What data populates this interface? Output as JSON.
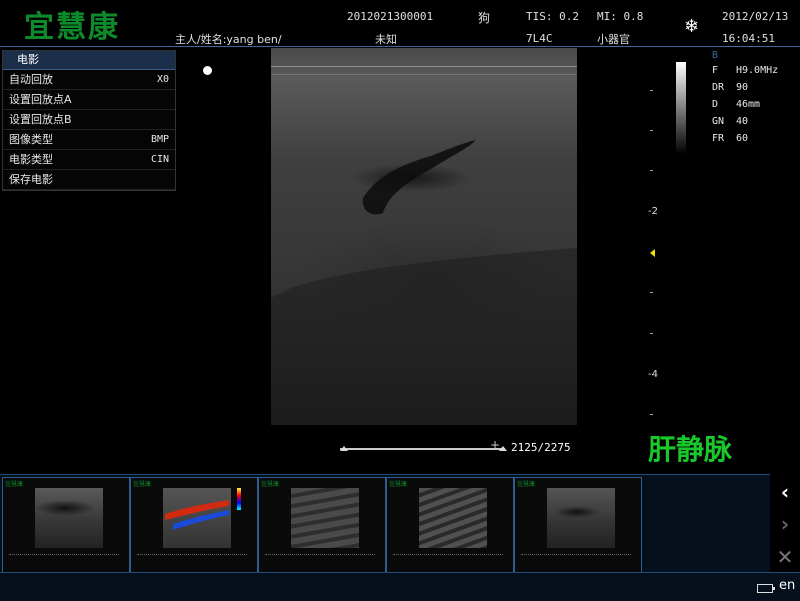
{
  "header": {
    "logo": "宜慧康",
    "patient_id": "2012021300001",
    "species": "狗",
    "tis": "TIS: 0.2",
    "mi": "MI: 0.8",
    "date": "2012/02/13",
    "owner": "主人/姓名:yang ben/",
    "gender": "未知",
    "probe": "7L4C",
    "preset": "小器官",
    "time": "16:04:51",
    "freeze_icon": "snowflake-icon"
  },
  "menu": {
    "title": "电影",
    "items": [
      {
        "label": "自动回放",
        "value": "X0"
      },
      {
        "label": "设置回放点A",
        "value": ""
      },
      {
        "label": "设置回放点B",
        "value": ""
      },
      {
        "label": "图像类型",
        "value": "BMP"
      },
      {
        "label": "电影类型",
        "value": "CIN"
      },
      {
        "label": "保存电影",
        "value": ""
      }
    ]
  },
  "params": {
    "mode": "B",
    "rows": [
      {
        "key": "F",
        "value": "H9.0MHz"
      },
      {
        "key": "DR",
        "value": "90"
      },
      {
        "key": "D",
        "value": "46mm"
      },
      {
        "key": "GN",
        "value": "40"
      },
      {
        "key": "FR",
        "value": "60"
      }
    ]
  },
  "depth_scale": {
    "labels": [
      "-2",
      "-4"
    ]
  },
  "cine": {
    "frame_counter": "2125/2275"
  },
  "annotation": "肝静脉",
  "thumbnails": [
    {
      "logo": "宜慧康",
      "kind": "b-mode"
    },
    {
      "logo": "宜慧康",
      "kind": "color-doppler"
    },
    {
      "logo": "宜慧康",
      "kind": "b-mode"
    },
    {
      "logo": "宜慧康",
      "kind": "b-mode"
    },
    {
      "logo": "宜慧康",
      "kind": "b-mode"
    }
  ],
  "nav": {
    "back": "‹",
    "forward": "›",
    "close": "✕"
  },
  "status": {
    "language": "en",
    "battery_icon": "battery-icon"
  },
  "colors": {
    "logo_green": "#0d8a2a",
    "annotation_green": "#19c82a",
    "focus_marker": "#e8e800",
    "frame_blue": "#2c5d8c"
  }
}
